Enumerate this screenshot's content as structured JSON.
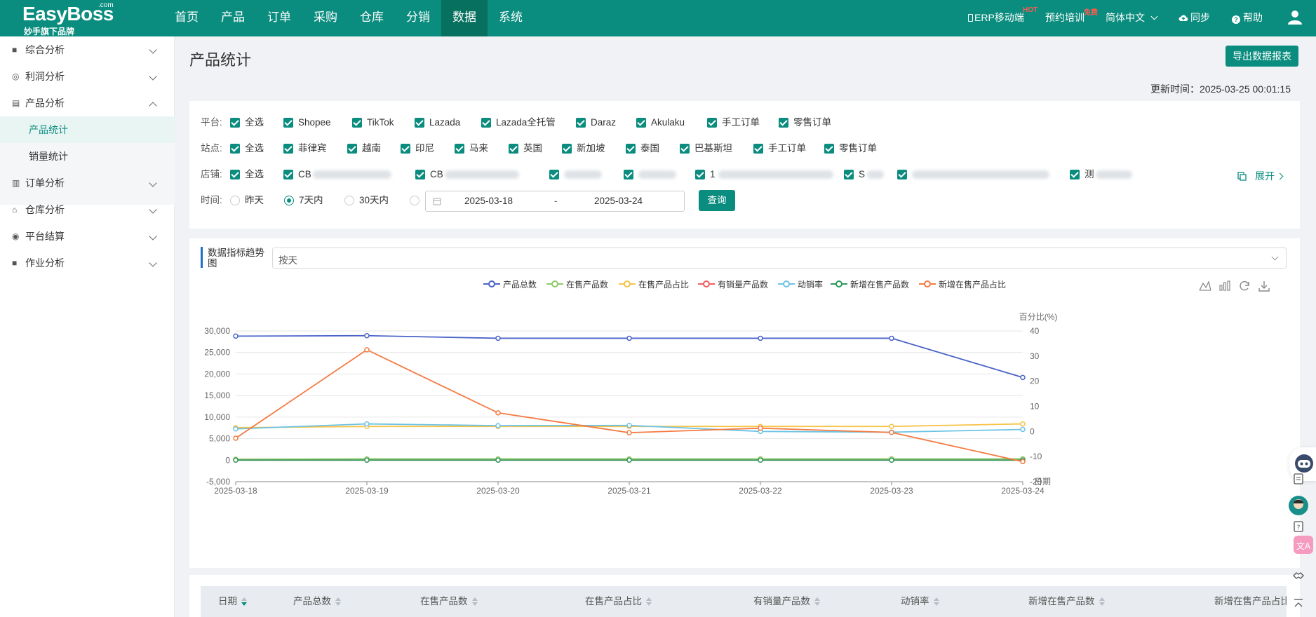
{
  "brand": {
    "name": "EasyBoss",
    "com": ".com",
    "sub": "妙手旗下品牌"
  },
  "nav": [
    "首页",
    "产品",
    "订单",
    "采购",
    "仓库",
    "分销",
    "数据",
    "系统"
  ],
  "nav_active": "数据",
  "top_right": {
    "erp": "ERP移动端",
    "erp_tag": "HOT",
    "training": "预约培训",
    "training_tag": "免费",
    "lang": "简体中文",
    "sync": "同步",
    "help": "帮助"
  },
  "sidebar": {
    "items": [
      "综合分析",
      "利润分析",
      "产品分析",
      "订单分析",
      "仓库分析",
      "平台结算",
      "作业分析"
    ],
    "sub_items": [
      "产品统计",
      "销量统计"
    ]
  },
  "page": {
    "title": "产品统计",
    "export_label": "导出数据报表",
    "update_time": "更新时间：2025-03-25 00:01:15"
  },
  "filters": {
    "platform_label": "平台:",
    "platforms": [
      "全选",
      "Shopee",
      "TikTok",
      "Lazada",
      "Lazada全托管",
      "Daraz",
      "Akulaku",
      "手工订单",
      "零售订单"
    ],
    "site_label": "站点:",
    "sites": [
      "全选",
      "菲律宾",
      "越南",
      "印尼",
      "马来",
      "英国",
      "新加坡",
      "泰国",
      "巴基斯坦",
      "手工订单",
      "零售订单"
    ],
    "store_label": "店铺:",
    "stores": [
      "全选",
      "CB",
      "CB",
      "",
      "",
      "1",
      "S",
      "",
      "测"
    ],
    "expand_label": "展开",
    "time_label": "时间:",
    "time_options": [
      "昨天",
      "7天内",
      "30天内"
    ],
    "time_selected": "7天内",
    "date_start": "2025-03-18",
    "date_sep": "-",
    "date_end": "2025-03-24",
    "query_label": "查询"
  },
  "trend": {
    "title": "数据指标趋势图",
    "granularity": "按天"
  },
  "chart_data": {
    "type": "line",
    "x": [
      "2025-03-18",
      "2025-03-19",
      "2025-03-20",
      "2025-03-21",
      "2025-03-22",
      "2025-03-23",
      "2025-03-24"
    ],
    "left_axis": {
      "ticks": [
        "30,000",
        "25,000",
        "20,000",
        "15,000",
        "10,000",
        "5,000",
        "0",
        "-5,000"
      ],
      "ylim": [
        -5000,
        30000
      ]
    },
    "right_axis": {
      "label": "百分比(%)",
      "ticks": [
        "40",
        "30",
        "20",
        "10",
        "0",
        "-10",
        "-20"
      ],
      "ylim": [
        -20,
        40
      ]
    },
    "x_axis_name": "日期",
    "legend_position": "top-center",
    "grid": true,
    "series": [
      {
        "name": "产品总数",
        "axis": "left",
        "color": "#4a63c8",
        "values": [
          28800,
          28900,
          28300,
          28300,
          28300,
          28300,
          19200
        ]
      },
      {
        "name": "在售产品数",
        "axis": "left",
        "color": "#8dcb6a",
        "values": [
          200,
          300,
          300,
          300,
          300,
          300,
          300
        ]
      },
      {
        "name": "在售产品占比",
        "axis": "right",
        "color": "#f7c34a",
        "values": [
          1.5,
          2,
          2,
          2,
          2,
          2,
          3
        ]
      },
      {
        "name": "有销量产品数",
        "axis": "left",
        "color": "#ef5d5d",
        "values": [
          0,
          0,
          0,
          0,
          0,
          0,
          0
        ]
      },
      {
        "name": "动销率",
        "axis": "right",
        "color": "#6cc3e4",
        "values": [
          1,
          3,
          2.3,
          2.4,
          0,
          -0.3,
          0.8
        ]
      },
      {
        "name": "新增在售产品数",
        "axis": "left",
        "color": "#2e9a5c",
        "values": [
          0,
          0,
          0,
          0,
          0,
          0,
          0
        ]
      },
      {
        "name": "新增在售产品占比",
        "axis": "right",
        "color": "#f47a42",
        "values": [
          -2.7,
          32.5,
          7.4,
          -0.5,
          1.3,
          -0.4,
          -12
        ]
      }
    ]
  },
  "table": {
    "headers": [
      "日期",
      "产品总数",
      "在售产品数",
      "在售产品占比",
      "有销量产品数",
      "动销率",
      "新增在售产品数",
      "新增在售产品占比"
    ]
  }
}
